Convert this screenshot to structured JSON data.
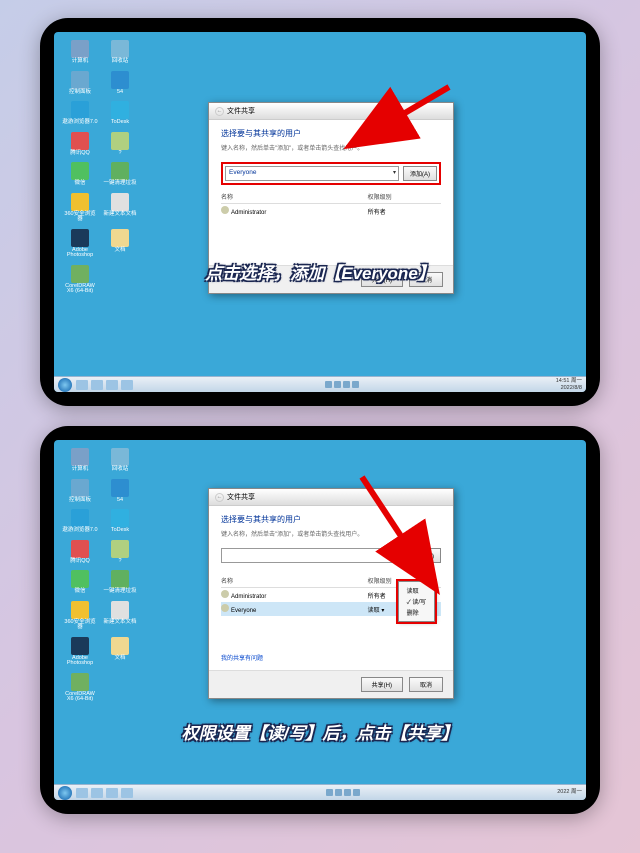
{
  "icons": [
    {
      "label": "计算机",
      "bg": "#7aa0c8"
    },
    {
      "label": "回收站",
      "bg": "#7ab8d8"
    },
    {
      "label": "控制面板",
      "bg": "#6aa8d0"
    },
    {
      "label": "54",
      "bg": "#2d8ed0"
    },
    {
      "label": "遨游浏览器7.0",
      "bg": "#2aa0d8"
    },
    {
      "label": "ToDesk",
      "bg": "#30b0e0"
    },
    {
      "label": "腾讯QQ",
      "bg": "#e05050"
    },
    {
      "label": "?",
      "bg": "#b0d080"
    },
    {
      "label": "微信",
      "bg": "#50c060"
    },
    {
      "label": "一键清理垃圾",
      "bg": "#60b060"
    },
    {
      "label": "360安全浏览器",
      "bg": "#f0c030"
    },
    {
      "label": "新建文本文档",
      "bg": "#e0e0e0"
    },
    {
      "label": "Adobe Photoshop",
      "bg": "#1a3a5a"
    },
    {
      "label": "文档",
      "bg": "#f0d890"
    },
    {
      "label": "CorelDRAW X6 (64-Bit)",
      "bg": "#70b060"
    },
    {
      "label": "",
      "bg": "transparent"
    }
  ],
  "dialog": {
    "titlebar_icon": "↩",
    "title": "文件共享",
    "heading": "选择要与其共享的用户",
    "subheading": "键入名称，然后单击\"添加\"，或者单击箭头查找用户。",
    "input_value": "Everyone",
    "add_label": "添加(A)",
    "col_name": "名称",
    "col_perm": "权限级别",
    "users": [
      {
        "name": "Administrator",
        "perm": "所有者",
        "selected": false
      }
    ],
    "users2": [
      {
        "name": "Administrator",
        "perm": "所有者",
        "selected": false
      },
      {
        "name": "Everyone",
        "perm": "读取 ▾",
        "selected": true
      }
    ],
    "perm_options": [
      "读取",
      "读/写",
      "删除"
    ],
    "troubleshoot": "我的共享有问题",
    "share_btn": "共享(H)",
    "cancel_btn": "取消"
  },
  "captions": {
    "top": "点击选择，添加【Everyone】",
    "bottom": "权限设置【读/写】后，点击【共享】"
  },
  "taskbar": {
    "time1": "14:51 周一",
    "date1": "2022/8/8",
    "time2": "2022 周一",
    "date2": ""
  }
}
